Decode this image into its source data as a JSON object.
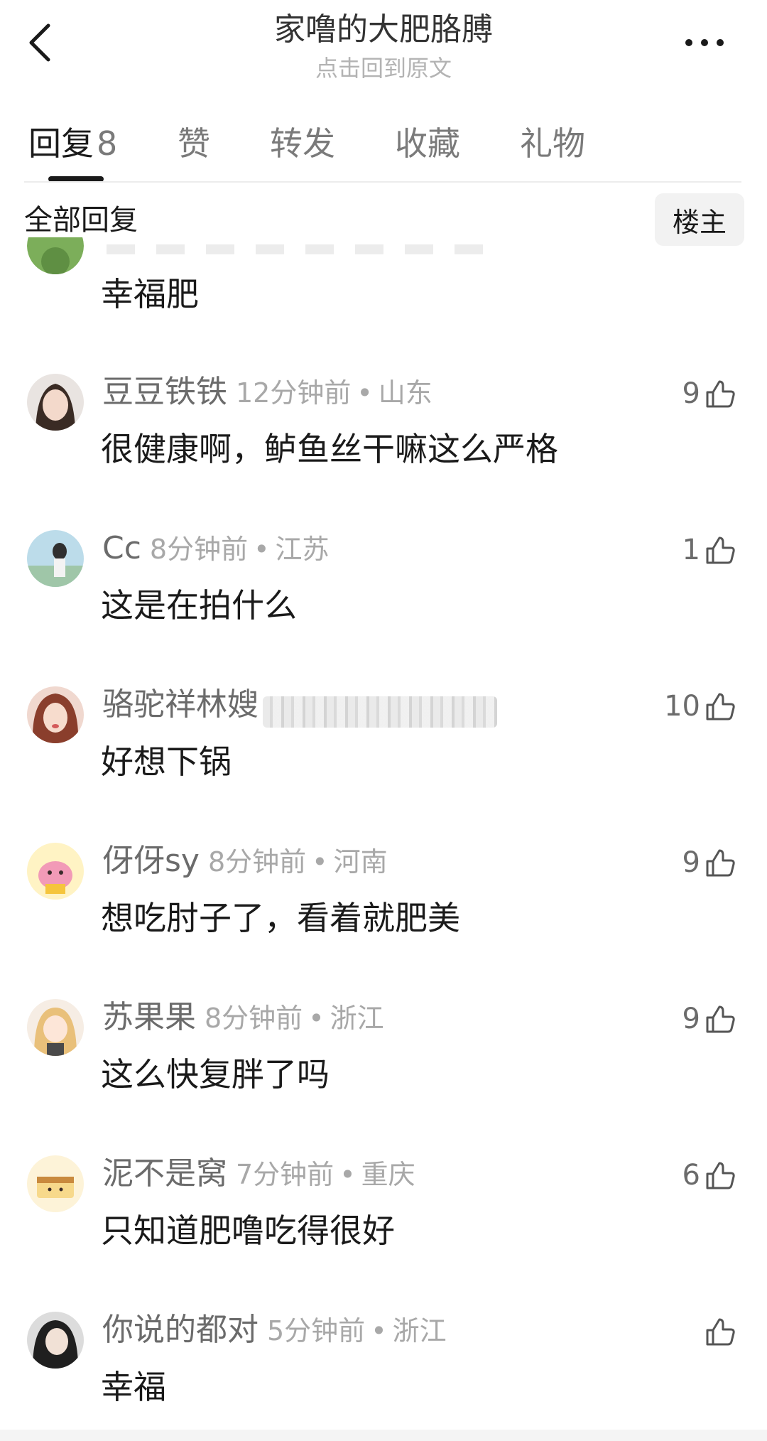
{
  "header": {
    "title": "家噜的大肥胳膊",
    "subtitle": "点击回到原文"
  },
  "tabs": [
    {
      "label": "回复",
      "count": "8"
    },
    {
      "label": "赞"
    },
    {
      "label": "转发"
    },
    {
      "label": "收藏"
    },
    {
      "label": "礼物"
    }
  ],
  "filter": {
    "label": "全部回复",
    "owner_button": "楼主"
  },
  "partial_comment": {
    "text": "幸福肥"
  },
  "comments": [
    {
      "user": "豆豆铁铁",
      "time": "12分钟前",
      "location": "山东",
      "text": "很健康啊，鲈鱼丝干嘛这么严格",
      "likes": "9"
    },
    {
      "user": "Cc",
      "time": "8分钟前",
      "location": "江苏",
      "text": "这是在拍什么",
      "likes": "1"
    },
    {
      "user": "骆驼祥林嫂",
      "time": "",
      "location": "",
      "text": "好想下锅",
      "likes": "10"
    },
    {
      "user": "伢伢sy",
      "time": "8分钟前",
      "location": "河南",
      "text": "想吃肘子了，看着就肥美",
      "likes": "9"
    },
    {
      "user": "苏果果",
      "time": "8分钟前",
      "location": "浙江",
      "text": "这么快复胖了吗",
      "likes": "9"
    },
    {
      "user": "泥不是窝",
      "time": "7分钟前",
      "location": "重庆",
      "text": "只知道肥噜吃得很好",
      "likes": "6"
    },
    {
      "user": "你说的都对",
      "time": "5分钟前",
      "location": "浙江",
      "text": "幸福",
      "likes": ""
    }
  ],
  "icons": {
    "back": "chevron-left-icon",
    "more": "more-dots-icon",
    "like": "thumbs-up-icon"
  },
  "colors": {
    "primary_text": "#1a1a1a",
    "secondary_text": "#6b6b6b",
    "muted_text": "#a8a8a8"
  },
  "separator_dot": "•"
}
